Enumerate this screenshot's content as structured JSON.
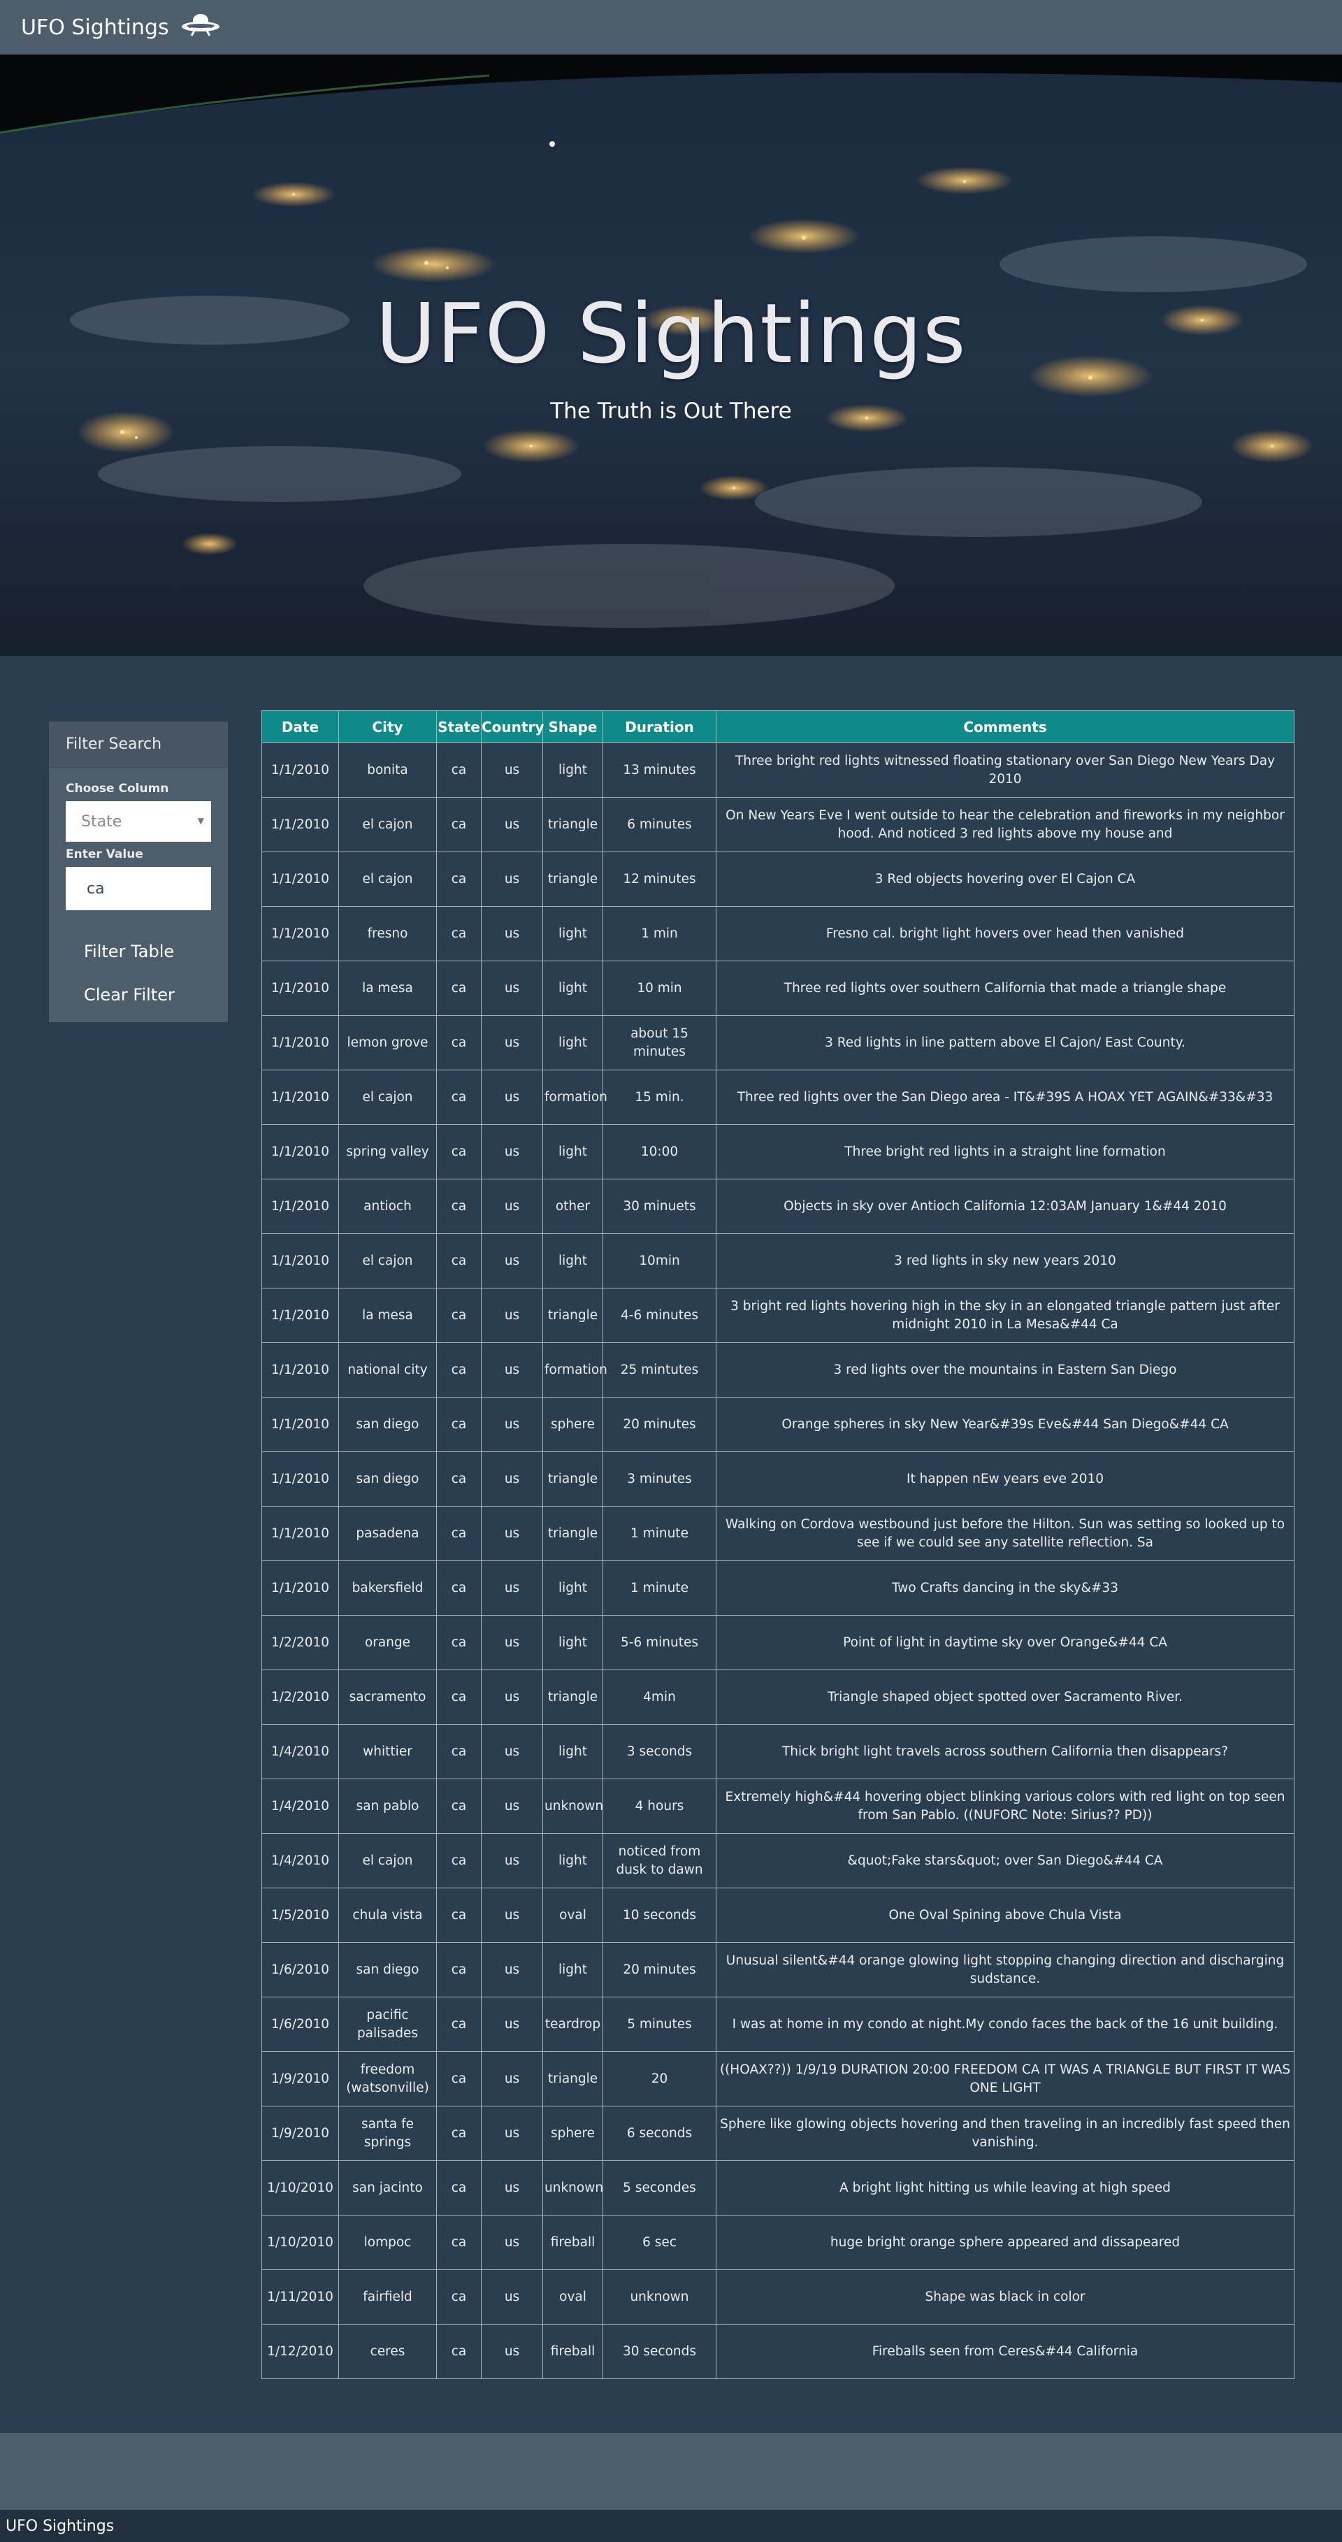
{
  "navbar": {
    "brand_label": "UFO Sightings",
    "brand_icon": "ufo-icon"
  },
  "hero": {
    "title": "UFO Sightings",
    "subtitle": "The Truth is Out There"
  },
  "filter": {
    "panel_title": "Filter Search",
    "column_label": "Choose Column",
    "column_select_value": "State",
    "value_label": "Enter Value",
    "value_input": "ca",
    "filter_button": "Filter Table",
    "clear_button": "Clear Filter"
  },
  "table": {
    "headers": [
      "Date",
      "City",
      "State",
      "Country",
      "Shape",
      "Duration",
      "Comments"
    ],
    "rows": [
      [
        "1/1/2010",
        "bonita",
        "ca",
        "us",
        "light",
        "13 minutes",
        "Three bright red lights witnessed floating stationary over San Diego New Years Day 2010"
      ],
      [
        "1/1/2010",
        "el cajon",
        "ca",
        "us",
        "triangle",
        "6 minutes",
        "On New Years Eve I went outside to hear the celebration and fireworks in my neighbor hood. And noticed 3 red lights above my house and"
      ],
      [
        "1/1/2010",
        "el cajon",
        "ca",
        "us",
        "triangle",
        "12 minutes",
        "3 Red objects hovering over El Cajon CA"
      ],
      [
        "1/1/2010",
        "fresno",
        "ca",
        "us",
        "light",
        "1 min",
        "Fresno cal. bright light hovers over head then vanished"
      ],
      [
        "1/1/2010",
        "la mesa",
        "ca",
        "us",
        "light",
        "10 min",
        "Three red lights over southern California that made a triangle shape"
      ],
      [
        "1/1/2010",
        "lemon grove",
        "ca",
        "us",
        "light",
        "about 15 minutes",
        "3 Red lights in line pattern above El Cajon/ East County."
      ],
      [
        "1/1/2010",
        "el cajon",
        "ca",
        "us",
        "formation",
        "15 min.",
        "Three red lights over the San Diego area - IT&#39S A HOAX YET AGAIN&#33&#33"
      ],
      [
        "1/1/2010",
        "spring valley",
        "ca",
        "us",
        "light",
        "10:00",
        "Three bright red lights in a straight line formation"
      ],
      [
        "1/1/2010",
        "antioch",
        "ca",
        "us",
        "other",
        "30 minuets",
        "Objects in sky over Antioch California 12:03AM January 1&#44 2010"
      ],
      [
        "1/1/2010",
        "el cajon",
        "ca",
        "us",
        "light",
        "10min",
        "3 red lights in sky new years 2010"
      ],
      [
        "1/1/2010",
        "la mesa",
        "ca",
        "us",
        "triangle",
        "4-6 minutes",
        "3 bright red lights hovering high in the sky in an elongated triangle pattern just after midnight 2010 in La Mesa&#44 Ca"
      ],
      [
        "1/1/2010",
        "national city",
        "ca",
        "us",
        "formation",
        "25 mintutes",
        "3 red lights over the mountains in Eastern San Diego"
      ],
      [
        "1/1/2010",
        "san diego",
        "ca",
        "us",
        "sphere",
        "20 minutes",
        "Orange spheres in sky New Year&#39s Eve&#44 San Diego&#44 CA"
      ],
      [
        "1/1/2010",
        "san diego",
        "ca",
        "us",
        "triangle",
        "3 minutes",
        "It happen nEw years eve 2010"
      ],
      [
        "1/1/2010",
        "pasadena",
        "ca",
        "us",
        "triangle",
        "1 minute",
        "Walking on Cordova westbound just before the Hilton. Sun was setting so looked up to see if we could see any satellite reflection. Sa"
      ],
      [
        "1/1/2010",
        "bakersfield",
        "ca",
        "us",
        "light",
        "1 minute",
        "Two Crafts dancing in the sky&#33"
      ],
      [
        "1/2/2010",
        "orange",
        "ca",
        "us",
        "light",
        "5-6 minutes",
        "Point of light in daytime sky over Orange&#44 CA"
      ],
      [
        "1/2/2010",
        "sacramento",
        "ca",
        "us",
        "triangle",
        "4min",
        "Triangle shaped object spotted over Sacramento River."
      ],
      [
        "1/4/2010",
        "whittier",
        "ca",
        "us",
        "light",
        "3 seconds",
        "Thick bright light travels across southern California then disappears?"
      ],
      [
        "1/4/2010",
        "san pablo",
        "ca",
        "us",
        "unknown",
        "4 hours",
        "Extremely high&#44 hovering object blinking various colors with red light on top seen from San Pablo. ((NUFORC Note: Sirius?? PD))"
      ],
      [
        "1/4/2010",
        "el cajon",
        "ca",
        "us",
        "light",
        "noticed from dusk to dawn",
        "&quot;Fake stars&quot; over San Diego&#44 CA"
      ],
      [
        "1/5/2010",
        "chula vista",
        "ca",
        "us",
        "oval",
        "10 seconds",
        "One Oval Spining above Chula Vista"
      ],
      [
        "1/6/2010",
        "san diego",
        "ca",
        "us",
        "light",
        "20 minutes",
        "Unusual silent&#44 orange glowing light stopping changing direction and discharging sudstance."
      ],
      [
        "1/6/2010",
        "pacific palisades",
        "ca",
        "us",
        "teardrop",
        "5 minutes",
        "I was at home in my condo at night.My condo faces the back of the 16 unit building."
      ],
      [
        "1/9/2010",
        "freedom (watsonville)",
        "ca",
        "us",
        "triangle",
        "20",
        "((HOAX??)) 1/9/19 DURATION 20:00 FREEDOM CA IT WAS A TRIANGLE BUT FIRST IT WAS ONE LIGHT"
      ],
      [
        "1/9/2010",
        "santa fe springs",
        "ca",
        "us",
        "sphere",
        "6 seconds",
        "Sphere like glowing objects hovering and then traveling in an incredibly fast speed then vanishing."
      ],
      [
        "1/10/2010",
        "san jacinto",
        "ca",
        "us",
        "unknown",
        "5 secondes",
        "A bright light hitting us while leaving at high speed"
      ],
      [
        "1/10/2010",
        "lompoc",
        "ca",
        "us",
        "fireball",
        "6 sec",
        "huge bright orange sphere appeared and dissapeared"
      ],
      [
        "1/11/2010",
        "fairfield",
        "ca",
        "us",
        "oval",
        "unknown",
        "Shape was black in color"
      ],
      [
        "1/12/2010",
        "ceres",
        "ca",
        "us",
        "fireball",
        "30 seconds",
        "Fireballs seen from Ceres&#44 California"
      ]
    ]
  },
  "footer": {
    "label": "UFO Sightings"
  },
  "colors": {
    "page_bg": "#2b3e50",
    "navbar_bg": "#4e5d6c",
    "table_header_bg": "#0f8a8a",
    "footer_bg": "#21303f"
  }
}
